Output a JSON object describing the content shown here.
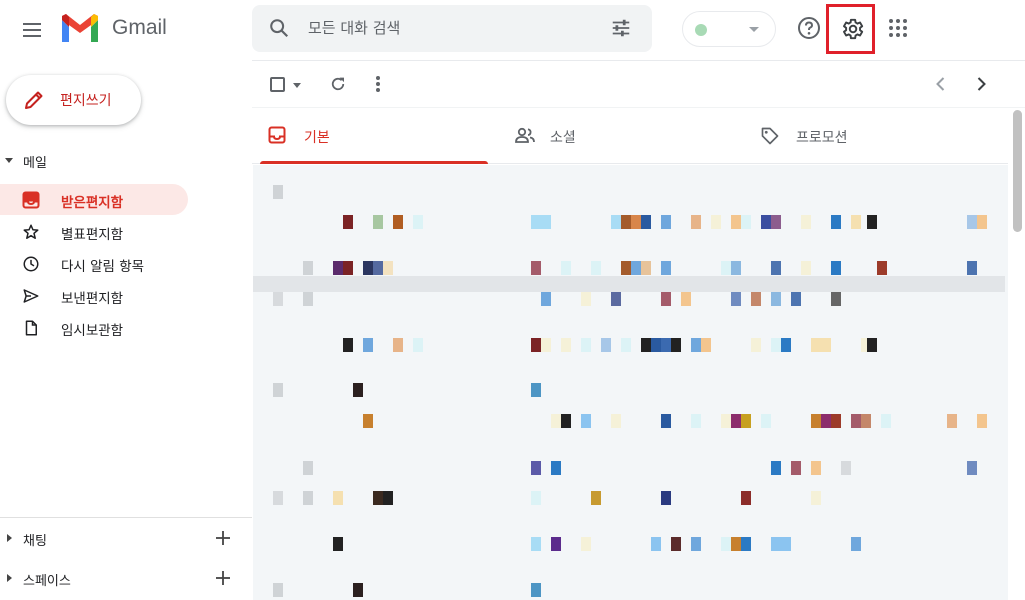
{
  "header": {
    "app_name": "Gmail",
    "search_placeholder": "모든 대화 검색"
  },
  "sidebar": {
    "compose_label": "편지쓰기",
    "mail_section": "메일",
    "items": [
      {
        "label": "받은편지함",
        "icon": "inbox-icon",
        "active": true
      },
      {
        "label": "별표편지함",
        "icon": "star-icon",
        "active": false
      },
      {
        "label": "다시 알림 항목",
        "icon": "clock-icon",
        "active": false
      },
      {
        "label": "보낸편지함",
        "icon": "send-icon",
        "active": false
      },
      {
        "label": "임시보관함",
        "icon": "draft-icon",
        "active": false
      }
    ],
    "chat_section": "채팅",
    "spaces_section": "스페이스"
  },
  "tabs": [
    {
      "label": "기본",
      "icon": "inbox-tab-icon",
      "active": true
    },
    {
      "label": "소셜",
      "icon": "people-icon",
      "active": false
    },
    {
      "label": "프로모션",
      "icon": "tag-icon",
      "active": false
    }
  ],
  "colors": {
    "accent": "#d93025",
    "highlight_box": "#e0202a",
    "active_nav_bg": "#fce8e6",
    "status_dot": "#a8dab5"
  }
}
